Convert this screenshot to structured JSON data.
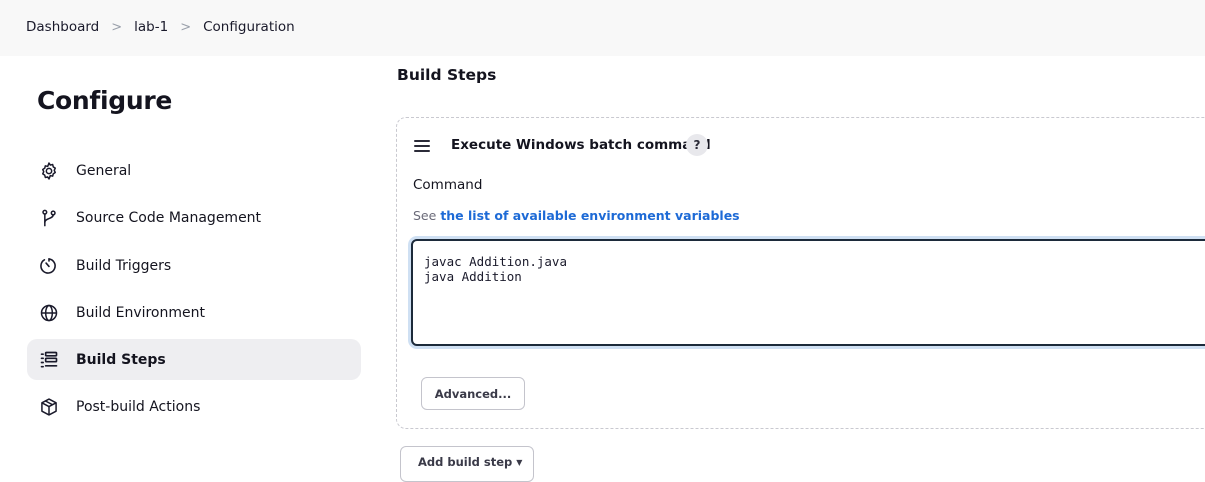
{
  "breadcrumb": {
    "items": [
      "Dashboard",
      "lab-1",
      "Configuration"
    ],
    "separator": ">"
  },
  "sidebar": {
    "title": "Configure",
    "items": [
      {
        "label": "General",
        "icon": "gear-icon"
      },
      {
        "label": "Source Code Management",
        "icon": "branch-icon"
      },
      {
        "label": "Build Triggers",
        "icon": "clock-icon"
      },
      {
        "label": "Build Environment",
        "icon": "globe-icon"
      },
      {
        "label": "Build Steps",
        "icon": "list-icon",
        "active": true
      },
      {
        "label": "Post-build Actions",
        "icon": "package-icon"
      }
    ]
  },
  "main": {
    "section_title": "Build Steps",
    "step": {
      "title": "Execute Windows batch command",
      "help": "?",
      "command_label": "Command",
      "env_prefix": "See",
      "env_link": "the list of available environment variables",
      "command_value": "javac Addition.java\njava Addition",
      "advanced_label": "Advanced..."
    },
    "add_step_label": "Add build step",
    "add_step_caret": "▼"
  },
  "colors": {
    "link": "#1d6ad6",
    "active_bg": "#eeeef1",
    "focus_ring": "#cfe0f3"
  }
}
